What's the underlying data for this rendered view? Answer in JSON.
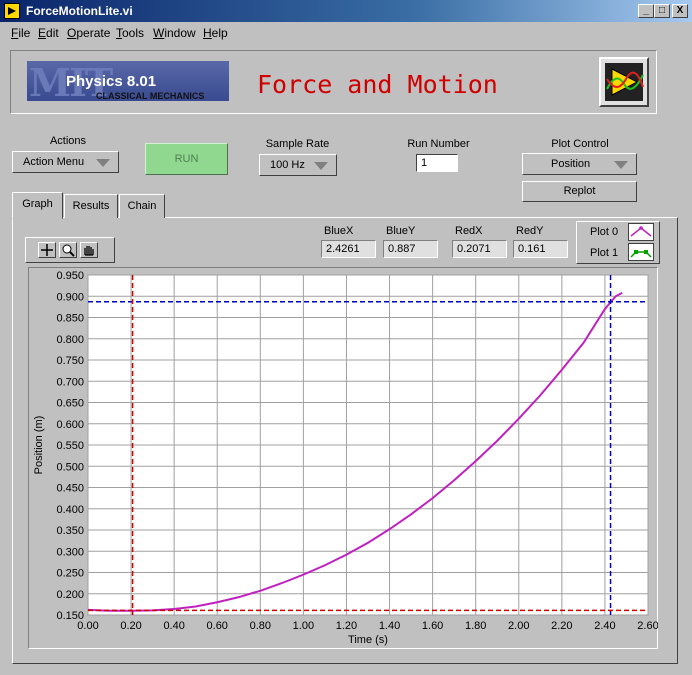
{
  "window": {
    "title": "ForceMotionLite.vi",
    "buttons": [
      "_",
      "□",
      "X"
    ]
  },
  "menu": {
    "items": [
      {
        "label": "File",
        "u": "F",
        "rest": "ile"
      },
      {
        "label": "Edit",
        "u": "E",
        "rest": "dit"
      },
      {
        "label": "Operate",
        "u": "O",
        "rest": "perate"
      },
      {
        "label": "Tools",
        "u": "T",
        "rest": "ools"
      },
      {
        "label": "Window",
        "u": "W",
        "rest": "indow"
      },
      {
        "label": "Help",
        "u": "H",
        "rest": "elp"
      }
    ]
  },
  "header": {
    "logo_mit": "MIT",
    "logo_course": "Physics 8.01",
    "logo_subtitle": "CLASSICAL MECHANICS",
    "title": "Force and Motion"
  },
  "controls": {
    "actions_label": "Actions",
    "actions_value": "Action Menu",
    "run_label": "RUN",
    "sample_rate_label": "Sample Rate",
    "sample_rate_value": "100 Hz",
    "run_number_label": "Run Number",
    "run_number_value": "1",
    "plot_control_label": "Plot Control",
    "plot_control_value": "Position",
    "replot_label": "Replot"
  },
  "tabs": [
    {
      "label": "Graph",
      "active": true
    },
    {
      "label": "Results",
      "active": false
    },
    {
      "label": "Chain",
      "active": false
    }
  ],
  "cursors": {
    "bluex_label": "BlueX",
    "bluex_value": "2.4261",
    "bluey_label": "BlueY",
    "bluey_value": "0.887",
    "redx_label": "RedX",
    "redx_value": "0.2071",
    "redy_label": "RedY",
    "redy_value": "0.161"
  },
  "legend": {
    "plot0": "Plot 0",
    "plot1": "Plot 1",
    "plot0_color": "#c020c0",
    "plot1_color": "#00a000"
  },
  "colors": {
    "series": "#c020c0",
    "blue_cursor": "#0000c0",
    "red_cursor": "#d00000",
    "title": "#d00000",
    "run_button": "#90d890"
  },
  "chart_data": {
    "type": "line",
    "title": "",
    "xlabel": "Time (s)",
    "ylabel": "Position (m)",
    "xlim": [
      0,
      2.6
    ],
    "ylim": [
      0.15,
      0.95
    ],
    "xticks": [
      "0.00",
      "0.20",
      "0.40",
      "0.60",
      "0.80",
      "1.00",
      "1.20",
      "1.40",
      "1.60",
      "1.80",
      "2.00",
      "2.20",
      "2.40",
      "2.60"
    ],
    "yticks": [
      "0.150",
      "0.200",
      "0.250",
      "0.300",
      "0.350",
      "0.400",
      "0.450",
      "0.500",
      "0.550",
      "0.600",
      "0.650",
      "0.700",
      "0.750",
      "0.800",
      "0.850",
      "0.900",
      "0.950"
    ],
    "grid": true,
    "series": [
      {
        "x": [
          0.0,
          0.1,
          0.2,
          0.3,
          0.4,
          0.5,
          0.6,
          0.7,
          0.8,
          0.9,
          1.0,
          1.1,
          1.2,
          1.3,
          1.4,
          1.5,
          1.6,
          1.7,
          1.8,
          1.9,
          2.0,
          2.1,
          2.2,
          2.3,
          2.4,
          2.45,
          2.48
        ],
        "y": [
          0.162,
          0.16,
          0.16,
          0.161,
          0.164,
          0.17,
          0.18,
          0.192,
          0.207,
          0.225,
          0.245,
          0.267,
          0.292,
          0.32,
          0.352,
          0.387,
          0.425,
          0.467,
          0.512,
          0.56,
          0.612,
          0.667,
          0.727,
          0.79,
          0.87,
          0.9,
          0.908
        ]
      }
    ],
    "cursors": [
      {
        "name": "BlueX/BlueY",
        "x": 2.4261,
        "y": 0.887
      },
      {
        "name": "RedX/RedY",
        "x": 0.2071,
        "y": 0.161
      }
    ]
  }
}
